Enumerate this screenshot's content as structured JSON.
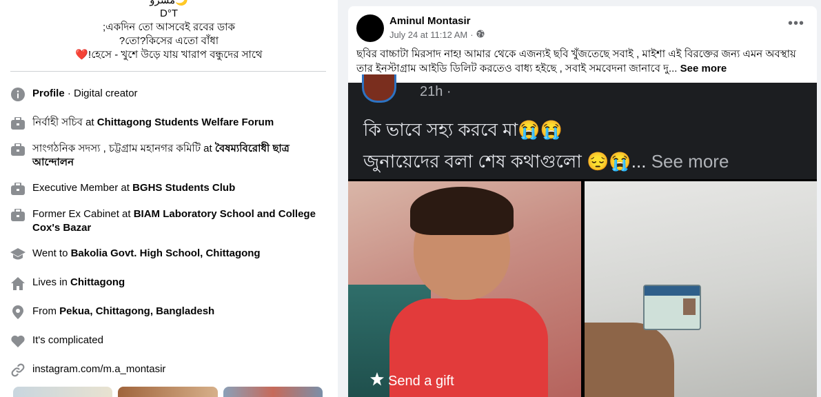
{
  "bio": {
    "line0": "مسرو🌙",
    "line1": "D°T",
    "line2": ";একদিন তো আসবেই রবের ডাক",
    "line3": "?তো?কিসের এতো বাঁধা",
    "line4": "❤️!হেসে - খুশে উড়ে যায় খারাপ বন্ধুদের সাথে"
  },
  "intro": {
    "profile_label": "Profile",
    "profile_value": " · Digital creator",
    "work1_role": "নির্বাহী সচিব at ",
    "work1_org": "Chittagong Students Welfare Forum",
    "work2_role": "সাংগঠনিক সদস্য , চট্টগ্রাম মহানগর কমিটি at ",
    "work2_org": "বৈষম্যবিরোধী ছাত্র আন্দোলন",
    "work3_role": "Executive Member at ",
    "work3_org": "BGHS Students Club",
    "work4_role": "Former Ex Cabinet at ",
    "work4_org": "BIAM Laboratory School and College Cox's Bazar",
    "edu_prefix": "Went to ",
    "edu_school": "Bakolia Govt. High School, Chittagong",
    "lives_prefix": "Lives in ",
    "lives_city": "Chittagong",
    "from_prefix": "From ",
    "from_place": "Pekua, Chittagong, Bangladesh",
    "relationship": "It's complicated",
    "link": "instagram.com/m.a_montasir"
  },
  "post": {
    "author": "Aminul Montasir",
    "date": "July 24 at 11:12 AM",
    "sep": "·",
    "text": "ছবির বাচ্চাটা মিরসাদ নাহ! আমার থেকে এজন্যই ছবি খুঁজতেছে সবাই , মাইশা এই বিরক্তের জন্য এমন অবস্থায় তার ইনস্টাগ্রাম আইডি ডিলিট করতেও বাধ্য হইছে , সবাই সমবেদনা জানাবে দু...",
    "see_more": "See more",
    "shared": {
      "time": "21h ·",
      "line1": "কি ভাবে সহ্য করবে মা😭😭",
      "line2": "জুনায়েদের বলা শেষ কথাগুলো 😔😭...",
      "see_more": "See more",
      "gift": "Send a gift"
    }
  },
  "icons": {
    "info": "info-icon",
    "work": "briefcase-icon",
    "education": "graduation-cap-icon",
    "home": "home-icon",
    "location": "location-pin-icon",
    "relationship": "heart-icon",
    "link": "link-icon",
    "privacy": "globe-icon",
    "more": "more-options-icon",
    "gift": "gift-icon"
  },
  "colors": {
    "text_primary": "#050505",
    "text_secondary": "#65676b",
    "icon": "#8a8d91",
    "page_bg": "#f0f2f5"
  }
}
